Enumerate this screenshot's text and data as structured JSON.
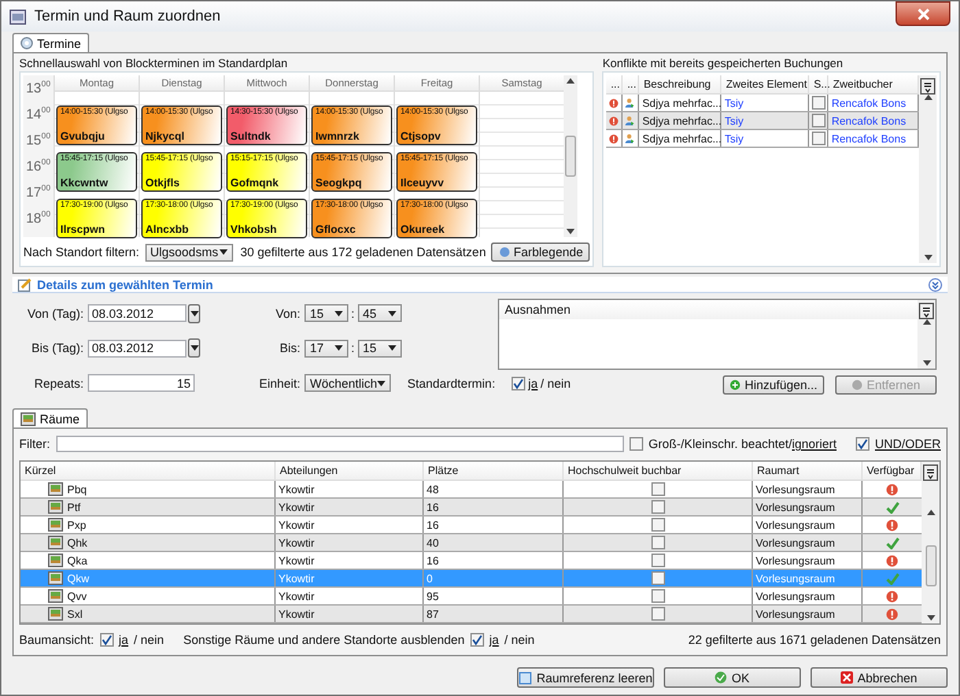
{
  "window": {
    "title": "Termin und Raum zuordnen"
  },
  "top_tab": {
    "label": "Termine",
    "selected": true
  },
  "calendar": {
    "title": "Schnellauswahl von Blockterminen im Standardplan",
    "times": [
      {
        "hour": "13",
        "minute": "00"
      },
      {
        "hour": "14",
        "minute": "00"
      },
      {
        "hour": "15",
        "minute": "00"
      },
      {
        "hour": "16",
        "minute": "00"
      },
      {
        "hour": "17",
        "minute": "00"
      },
      {
        "hour": "18",
        "minute": "00"
      }
    ],
    "days": [
      {
        "name": "Montag",
        "events": [
          {
            "time": "14:00-15:30 (Ulgso",
            "name": "Gvubqju",
            "color": "#f7901e"
          },
          {
            "time": "15:45-17:15 (Ulgso",
            "name": "Kkcwntw",
            "color": "#8cc98c"
          },
          {
            "time": "17:30-19:00 (Ulgso",
            "name": "Ilrscpwn",
            "color": "#ffff00"
          }
        ]
      },
      {
        "name": "Dienstag",
        "events": [
          {
            "time": "14:00-15:30 (Ulgso",
            "name": "Njkycql",
            "color": "#f7901e"
          },
          {
            "time": "15:45-17:15 (Ulgso",
            "name": "Otkjfls",
            "color": "#ffff00"
          },
          {
            "time": "17:30-18:00 (Ulgso",
            "name": "Alncxbb",
            "color": "#ffff00"
          }
        ]
      },
      {
        "name": "Mittwoch",
        "events": [
          {
            "time": "14:30-15:30 (Ulgso",
            "name": "Sultndk",
            "color": "#f25c6a"
          },
          {
            "time": "15:15-17:15 (Ulgso",
            "name": "Gofmqnk",
            "color": "#ffff00"
          },
          {
            "time": "17:30-19:00 (Ulgso",
            "name": "Vhkobsh",
            "color": "#ffff00"
          }
        ]
      },
      {
        "name": "Donnerstag",
        "events": [
          {
            "time": "14:00-15:30 (Ulgso",
            "name": "Iwmnrzk",
            "color": "#f7901e"
          },
          {
            "time": "15:45-17:15 (Ulgso",
            "name": "Seogkpq",
            "color": "#f7901e"
          },
          {
            "time": "17:30-18:00 (Ulgso",
            "name": "Gflocxc",
            "color": "#f7901e"
          }
        ]
      },
      {
        "name": "Freitag",
        "events": [
          {
            "time": "14:00-15:30 (Ulgso",
            "name": "Ctjsopv",
            "color": "#f7901e"
          },
          {
            "time": "15:45-17:15 (Ulgso",
            "name": "Ilceuyvv",
            "color": "#f7901e"
          },
          {
            "time": "17:30-18:00 (Ulgso",
            "name": "Okureek",
            "color": "#f7901e"
          }
        ]
      },
      {
        "name": "Samstag"
      }
    ],
    "filter_label": "Nach Standort filtern:",
    "filter_value": "Ulgsoodsms",
    "count": "30 gefilterte aus 172 geladenen Datensätzen",
    "legend_button": "Farblegende"
  },
  "conflicts": {
    "title": "Konflikte mit bereits gespeicherten Buchungen",
    "columns": [
      "...",
      "...",
      "Beschreibung",
      "Zweites Element",
      "S...",
      "Zweitbucher"
    ],
    "rows": [
      {
        "description": "Sdjya mehrfac...",
        "element": "Tsiy",
        "checked": false,
        "booker": "Rencafok Bons",
        "selected": false
      },
      {
        "description": "Sdjya mehrfac...",
        "element": "Tsiy",
        "checked": false,
        "booker": "Rencafok Bons",
        "selected": true
      },
      {
        "description": "Sdjya mehrfac...",
        "element": "Tsiy",
        "checked": false,
        "booker": "Rencafok Bons",
        "selected": false
      }
    ]
  },
  "details": {
    "title": "Details zum gewählten Termin",
    "from_day_label": "Von (Tag):",
    "from_day": "08.03.2012",
    "to_day_label": "Bis (Tag):",
    "to_day": "08.03.2012",
    "repeats_label": "Repeats:",
    "repeats": "15",
    "from_label": "Von:",
    "from_hour": "15",
    "from_sep": ":",
    "from_minute": "45",
    "to_label": "Bis:",
    "to_hour": "17",
    "to_sep": ":",
    "to_minute": "15",
    "unit_label": "Einheit:",
    "unit": "Wöchentlich",
    "standard_label": "Standardtermin:",
    "standard_checked": true,
    "yes": "ja",
    "no_sep": "/ nein",
    "exceptions_header": "Ausnahmen",
    "add_button": {
      "label": "Hinzufügen...",
      "disabled": false
    },
    "remove_button": {
      "label": "Entfernen",
      "disabled": true
    }
  },
  "rooms_tab": {
    "label": "Räume",
    "selected": true
  },
  "rooms": {
    "filter_label": "Filter:",
    "case_label": "Groß-/Kleinschr. beachtet/",
    "case_link": "ignoriert",
    "case_checked": false,
    "andor_label": "UND/ODER",
    "andor_checked": true,
    "columns": [
      "Kürzel",
      "Abteilungen",
      "Plätze",
      "Hochschulweit buchbar",
      "Raumart",
      "Verfügbar"
    ],
    "rows": [
      {
        "code": "Pbq",
        "dept": "Ykowtir",
        "seats": "48",
        "campus": false,
        "type": "Vorlesungsraum",
        "available": false,
        "selected": false
      },
      {
        "code": "Ptf",
        "dept": "Ykowtir",
        "seats": "16",
        "campus": false,
        "type": "Vorlesungsraum",
        "available": true,
        "selected": false
      },
      {
        "code": "Pxp",
        "dept": "Ykowtir",
        "seats": "16",
        "campus": false,
        "type": "Vorlesungsraum",
        "available": false,
        "selected": false
      },
      {
        "code": "Qhk",
        "dept": "Ykowtir",
        "seats": "40",
        "campus": false,
        "type": "Vorlesungsraum",
        "available": true,
        "selected": false
      },
      {
        "code": "Qka",
        "dept": "Ykowtir",
        "seats": "16",
        "campus": false,
        "type": "Vorlesungsraum",
        "available": false,
        "selected": false
      },
      {
        "code": "Qkw",
        "dept": "Ykowtir",
        "seats": "0",
        "campus": false,
        "type": "Vorlesungsraum",
        "available": true,
        "selected": true
      },
      {
        "code": "Qvv",
        "dept": "Ykowtir",
        "seats": "95",
        "campus": false,
        "type": "Vorlesungsraum",
        "available": false,
        "selected": false
      },
      {
        "code": "Sxl",
        "dept": "Ykowtir",
        "seats": "87",
        "campus": false,
        "type": "Vorlesungsraum",
        "available": false,
        "selected": false
      }
    ],
    "tree_label": "Baumansicht:",
    "tree_checked": true,
    "tree_yes": "ja",
    "tree_no": "/ nein",
    "hide_label": "Sonstige Räume und andere Standorte ausblenden",
    "hide_checked": true,
    "hide_yes": "ja",
    "hide_no": "/ nein",
    "count": "22 gefilterte aus 1671 geladenen Datensätzen"
  },
  "buttons": [
    "Raumreferenz leeren",
    "OK",
    "Abbrechen"
  ]
}
